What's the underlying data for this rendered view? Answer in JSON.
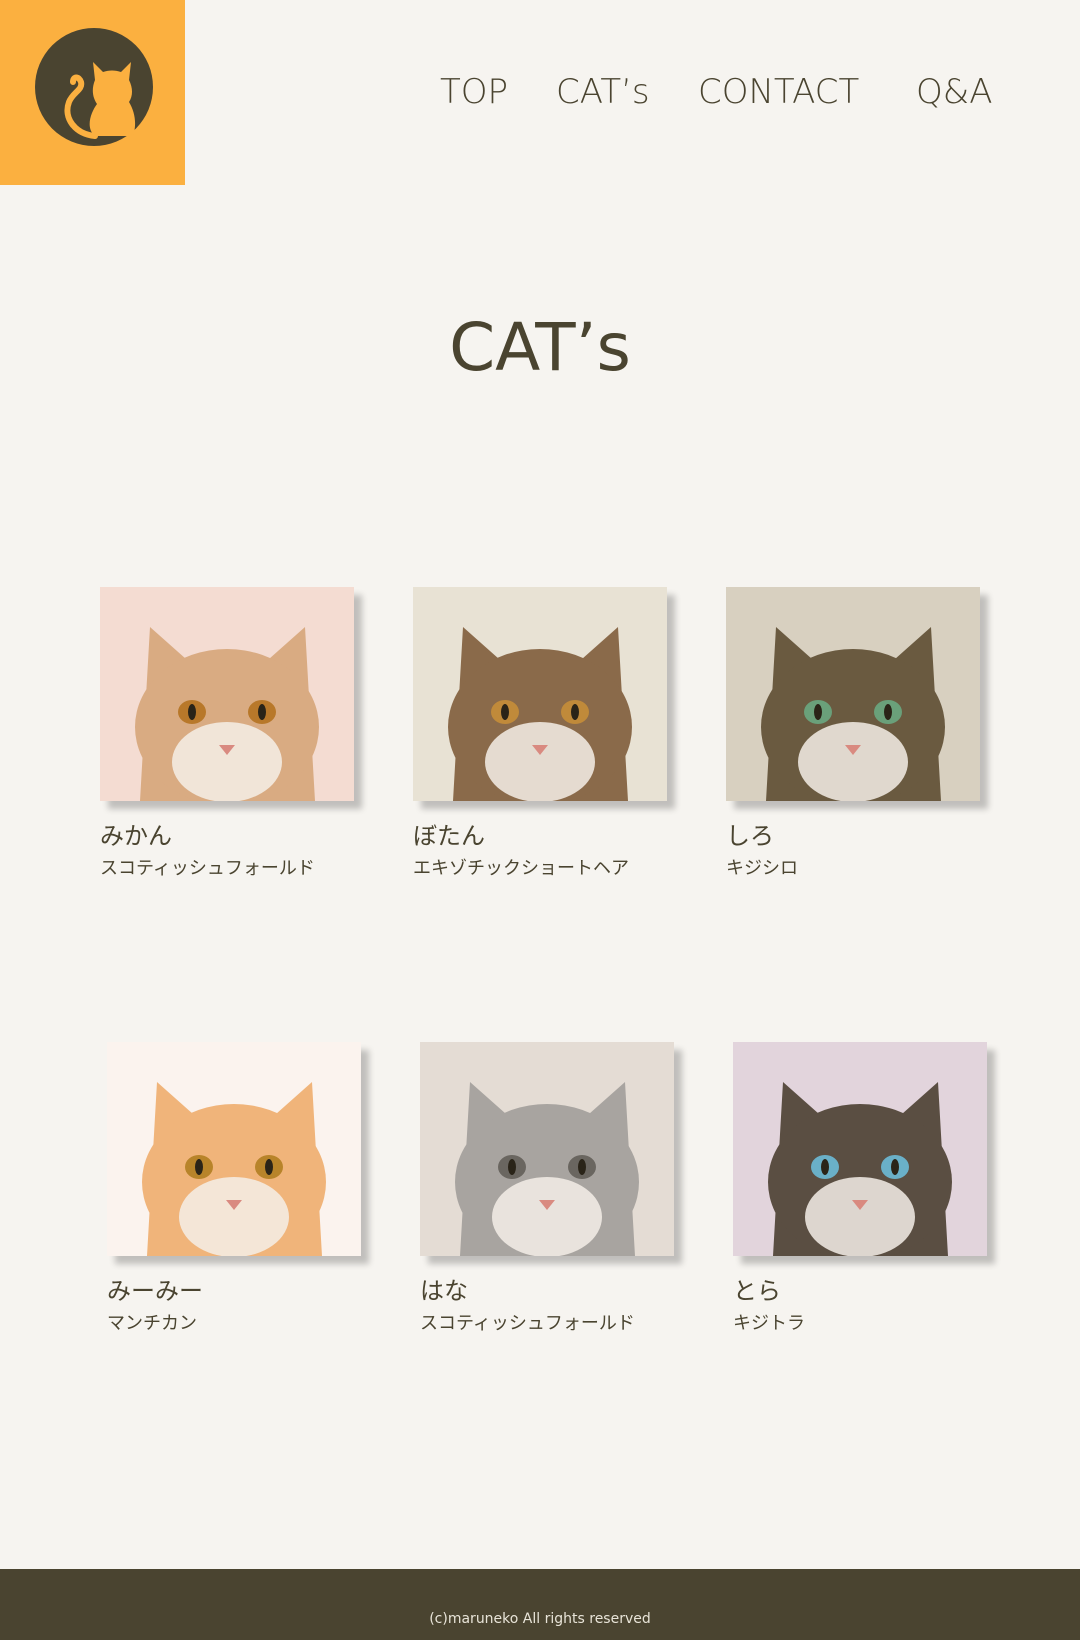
{
  "header": {
    "nav": [
      {
        "label": "TOP"
      },
      {
        "label": "CAT’s"
      },
      {
        "label": "CONTACT"
      },
      {
        "label": "Q&A"
      }
    ],
    "logo_icon": "cat-silhouette-icon",
    "logo_color": "#fbb040"
  },
  "main": {
    "title": "CAT’s",
    "cats": [
      {
        "name": "みかん",
        "breed": "スコティッシュフォールド",
        "fur": "#d9ab82",
        "bg": "#f4dcd2",
        "eye": "#b8782a"
      },
      {
        "name": "ぼたん",
        "breed": "エキゾチックショートヘア",
        "fur": "#8a6a4a",
        "bg": "#e8e2d4",
        "eye": "#c08a3a"
      },
      {
        "name": "しろ",
        "breed": "キジシロ",
        "fur": "#6a5a40",
        "bg": "#d8d0c0",
        "eye": "#6aa07a"
      },
      {
        "name": "みーみー",
        "breed": "マンチカン",
        "fur": "#f0b47a",
        "bg": "#fbf3ee",
        "eye": "#b8842a"
      },
      {
        "name": "はな",
        "breed": "スコティッシュフォールド",
        "fur": "#a8a4a0",
        "bg": "#e4dcd4",
        "eye": "#6a6660"
      },
      {
        "name": "とら",
        "breed": "キジトラ",
        "fur": "#5a4e42",
        "bg": "#e2d4dc",
        "eye": "#6ab0c8"
      }
    ]
  },
  "footer": {
    "copyright": "(c)maruneko All rights reserved"
  },
  "colors": {
    "background": "#f6f4f0",
    "text": "#4a4430",
    "accent": "#fbb040",
    "footer": "#4a4430"
  }
}
